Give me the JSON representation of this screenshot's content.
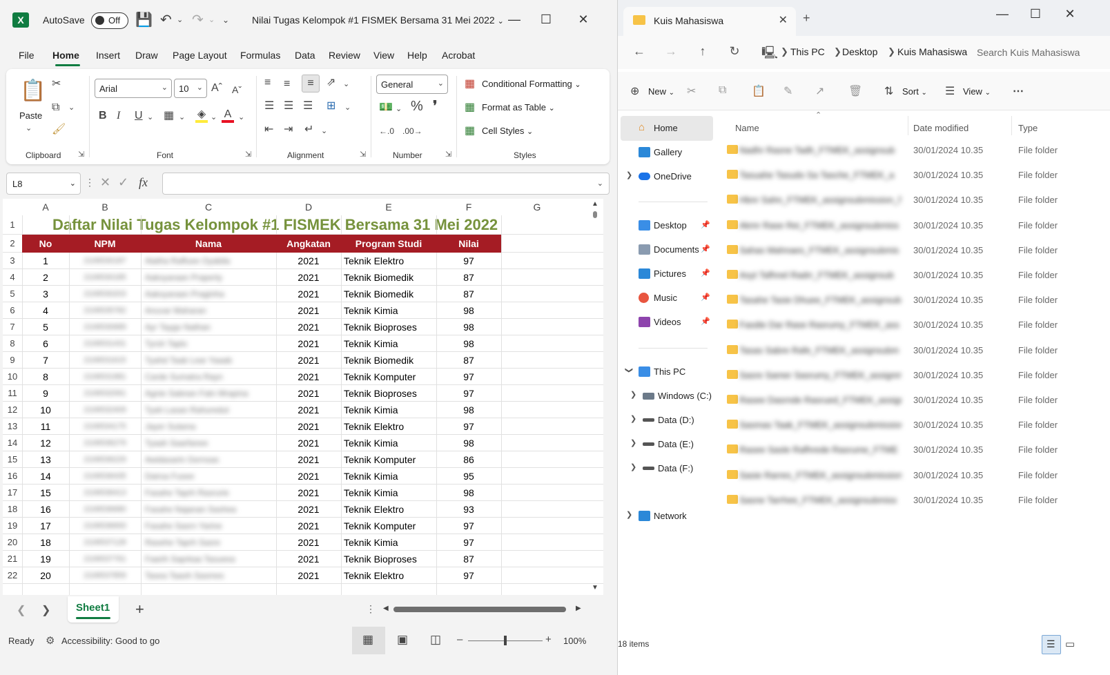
{
  "excel": {
    "autosave_label": "AutoSave",
    "autosave_state": "Off",
    "doc_title": "Nilai Tugas Kelompok #1 FISMEK Bersama 31 Mei 2022",
    "doc_title_chev": "⌄",
    "menu": [
      "File",
      "Home",
      "Insert",
      "Draw",
      "Page Layout",
      "Formulas",
      "Data",
      "Review",
      "View",
      "Help",
      "Acrobat"
    ],
    "ribbon": {
      "paste": "Paste",
      "clipboard": "Clipboard",
      "font_name": "Arial",
      "font_size": "10",
      "font": "Font",
      "alignment": "Alignment",
      "number_format": "General",
      "number": "Number",
      "conditional_formatting": "Conditional Formatting",
      "format_as_table": "Format as Table",
      "cell_styles": "Cell Styles",
      "styles": "Styles"
    },
    "name_box": "L8",
    "fx": "fx",
    "columns": [
      "A",
      "B",
      "C",
      "D",
      "E",
      "F",
      "G"
    ],
    "sheet_title": "Daftar Nilai Tugas Kelompok #1 FISMEK Bersama 31 Mei 2022",
    "headers": [
      "No",
      "NPM",
      "Nama",
      "Angkatan",
      "Program Studi",
      "Nilai"
    ],
    "rows": [
      {
        "no": "1",
        "npm": "2106530187",
        "nama": "Alatha Raffuee Oyabila",
        "angkatan": "2021",
        "prodi": "Teknik Elektro",
        "nilai": "97"
      },
      {
        "no": "2",
        "npm": "2106530185",
        "nama": "Aaksyaraan Praperty",
        "angkatan": "2021",
        "prodi": "Teknik Biomedik",
        "nilai": "87"
      },
      {
        "no": "3",
        "npm": "2106530203",
        "nama": "Aaksyaraan Praginha",
        "angkatan": "2021",
        "prodi": "Teknik Biomedik",
        "nilai": "87"
      },
      {
        "no": "4",
        "npm": "2106535782",
        "nama": "Anuvar Maharan",
        "angkatan": "2021",
        "prodi": "Teknik Kimia",
        "nilai": "98"
      },
      {
        "no": "5",
        "npm": "2106530689",
        "nama": "Ayr Taygo Nathan",
        "angkatan": "2021",
        "prodi": "Teknik Bioproses",
        "nilai": "98"
      },
      {
        "no": "6",
        "npm": "2106531431",
        "nama": "Tyrsh Taplo",
        "angkatan": "2021",
        "prodi": "Teknik Kimia",
        "nilai": "98"
      },
      {
        "no": "7",
        "npm": "2106531615",
        "nama": "Tyahd Taab Lear Yaaab",
        "angkatan": "2021",
        "prodi": "Teknik Biomedik",
        "nilai": "87"
      },
      {
        "no": "8",
        "npm": "2106531981",
        "nama": "Carde Sumatra Rayn",
        "angkatan": "2021",
        "prodi": "Teknik Komputer",
        "nilai": "97"
      },
      {
        "no": "9",
        "npm": "2106532061",
        "nama": "Agnie Sabnan Fatn Mrapina",
        "angkatan": "2021",
        "prodi": "Teknik Bioproses",
        "nilai": "97"
      },
      {
        "no": "10",
        "npm": "2106532409",
        "nama": "Tyah Lasan Rahuredut",
        "angkatan": "2021",
        "prodi": "Teknik Kimia",
        "nilai": "98"
      },
      {
        "no": "11",
        "npm": "2106534175",
        "nama": "Jayer Sulama",
        "angkatan": "2021",
        "prodi": "Teknik Elektro",
        "nilai": "97"
      },
      {
        "no": "12",
        "npm": "2106536279",
        "nama": "Tyaah Saarfanee",
        "angkatan": "2021",
        "prodi": "Teknik Kimia",
        "nilai": "98"
      },
      {
        "no": "13",
        "npm": "2106536229",
        "nama": "Awidasarin Gernsas",
        "angkatan": "2021",
        "prodi": "Teknik Komputer",
        "nilai": "86"
      },
      {
        "no": "14",
        "npm": "2106536435",
        "nama": "Dairsa Fusee",
        "angkatan": "2021",
        "prodi": "Teknik Kimia",
        "nilai": "95"
      },
      {
        "no": "15",
        "npm": "2106536413",
        "nama": "Fasahe Taprh Rasrurie",
        "angkatan": "2021",
        "prodi": "Teknik Kimia",
        "nilai": "98"
      },
      {
        "no": "16",
        "npm": "2106536680",
        "nama": "Fasahe Najanan Sashea",
        "angkatan": "2021",
        "prodi": "Teknik Elektro",
        "nilai": "93"
      },
      {
        "no": "17",
        "npm": "2106536693",
        "nama": "Fasahe Sasrn Yarine",
        "angkatan": "2021",
        "prodi": "Teknik Komputer",
        "nilai": "97"
      },
      {
        "no": "18",
        "npm": "2106537128",
        "nama": "Rasehe Taprh Sasre",
        "angkatan": "2021",
        "prodi": "Teknik Kimia",
        "nilai": "97"
      },
      {
        "no": "19",
        "npm": "2106537761",
        "nama": "Faarih Saprkaa Tasueea",
        "angkatan": "2021",
        "prodi": "Teknik Bioproses",
        "nilai": "87"
      },
      {
        "no": "20",
        "npm": "2106537859",
        "nama": "Tasea Taaoh Sasmes",
        "angkatan": "2021",
        "prodi": "Teknik Elektro",
        "nilai": "97"
      }
    ],
    "sheet_tab": "Sheet1",
    "status_ready": "Ready",
    "accessibility": "Accessibility: Good to go",
    "zoom": "100%",
    "accent": "#107c41",
    "header_fill": "#a51c24",
    "title_color": "#76923c"
  },
  "explorer": {
    "tab_title": "Kuis Mahasiswa",
    "breadcrumb": [
      "This PC",
      "Desktop",
      "Kuis Mahasiswa"
    ],
    "search_placeholder": "Search Kuis Mahasiswa",
    "commands": {
      "new": "New",
      "sort": "Sort",
      "view": "View"
    },
    "nav": {
      "home": "Home",
      "gallery": "Gallery",
      "onedrive": "OneDrive",
      "desktop": "Desktop",
      "documents": "Documents",
      "pictures": "Pictures",
      "music": "Music",
      "videos": "Videos",
      "thispc": "This PC",
      "windows_c": "Windows (C:)",
      "data_d": "Data (D:)",
      "data_e": "Data (E:)",
      "data_f": "Data (F:)",
      "network": "Network"
    },
    "columns": {
      "name": "Name",
      "date": "Date modified",
      "type": "Type"
    },
    "files": [
      {
        "name": "Nadhr Rasne Tadh_FTMEK_assignsub",
        "date": "30/01/2024 10.35",
        "type": "File folder"
      },
      {
        "name": "Tasuahe Tasudo Sa Tasche_FTMEK_a",
        "date": "30/01/2024 10.35",
        "type": "File folder"
      },
      {
        "name": "Hbnr Sahn_FTMEK_assignsubmission_f",
        "date": "30/01/2024 10.35",
        "type": "File folder"
      },
      {
        "name": "Akmr Rase Rei_FTMEK_assignsubmiss",
        "date": "30/01/2024 10.35",
        "type": "File folder"
      },
      {
        "name": "Sahas Mahnaes_FTMEK_assignsubmis",
        "date": "30/01/2024 10.35",
        "type": "File folder"
      },
      {
        "name": "Asyt Tafhnel Radrr_FTMEK_assignsub",
        "date": "30/01/2024 10.35",
        "type": "File folder"
      },
      {
        "name": "Tasahe Tasie Dhuee_FTMEK_assignsub",
        "date": "30/01/2024 10.35",
        "type": "File folder"
      },
      {
        "name": "Fasdie Dar Rase Rasrumy_FTMEK_ass",
        "date": "30/01/2024 10.35",
        "type": "File folder"
      },
      {
        "name": "Tasas Sabre Rafe_FTMEK_assignsubm",
        "date": "30/01/2024 10.35",
        "type": "File folder"
      },
      {
        "name": "Sasre Samer Sasrumy_FTMEK_assignm",
        "date": "30/01/2024 10.35",
        "type": "File folder"
      },
      {
        "name": "Rasee Dasrnde Rasrued_FTMEK_assign",
        "date": "30/01/2024 10.35",
        "type": "File folder"
      },
      {
        "name": "Sasmas Taak_FTMEK_assignsubmission",
        "date": "30/01/2024 10.35",
        "type": "File folder"
      },
      {
        "name": "Rasee Sasle Rafhrede Rasrume_FTME",
        "date": "30/01/2024 10.35",
        "type": "File folder"
      },
      {
        "name": "Sasie Rarres_FTMEK_assignsubmission",
        "date": "30/01/2024 10.35",
        "type": "File folder"
      },
      {
        "name": "Sasne Tarrhee_FTMEK_assignsubmiss",
        "date": "30/01/2024 10.35",
        "type": "File folder"
      }
    ],
    "item_count": "18 items",
    "folder_color": "#f7c347"
  }
}
